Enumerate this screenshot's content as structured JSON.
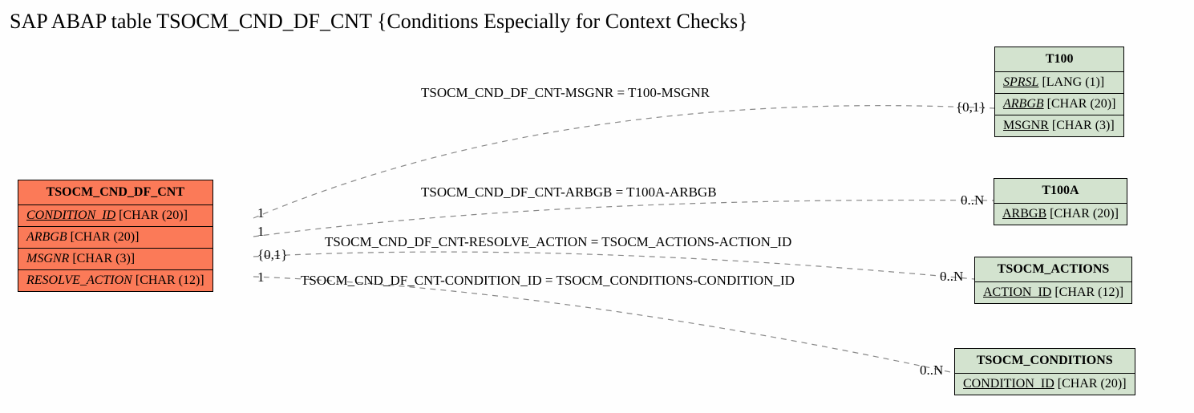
{
  "title": "SAP ABAP table TSOCM_CND_DF_CNT {Conditions Especially for Context Checks}",
  "main": {
    "name": "TSOCM_CND_DF_CNT",
    "fields": [
      {
        "label": "CONDITION_ID",
        "type": "[CHAR (20)]"
      },
      {
        "label": "ARBGB",
        "type": "[CHAR (20)]"
      },
      {
        "label": "MSGNR",
        "type": "[CHAR (3)]"
      },
      {
        "label": "RESOLVE_ACTION",
        "type": "[CHAR (12)]"
      }
    ]
  },
  "refs": {
    "t100": {
      "name": "T100",
      "fields": [
        {
          "label": "SPRSL",
          "type": "[LANG (1)]"
        },
        {
          "label": "ARBGB",
          "type": "[CHAR (20)]"
        },
        {
          "label": "MSGNR",
          "type": "[CHAR (3)]"
        }
      ]
    },
    "t100a": {
      "name": "T100A",
      "fields": [
        {
          "label": "ARBGB",
          "type": "[CHAR (20)]"
        }
      ]
    },
    "tsocm_actions": {
      "name": "TSOCM_ACTIONS",
      "fields": [
        {
          "label": "ACTION_ID",
          "type": "[CHAR (12)]"
        }
      ]
    },
    "tsocm_conditions": {
      "name": "TSOCM_CONDITIONS",
      "fields": [
        {
          "label": "CONDITION_ID",
          "type": "[CHAR (20)]"
        }
      ]
    }
  },
  "edges": {
    "e1": {
      "label": "TSOCM_CND_DF_CNT-MSGNR = T100-MSGNR",
      "card_left": "1",
      "card_right": "{0,1}"
    },
    "e2": {
      "label": "TSOCM_CND_DF_CNT-ARBGB = T100A-ARBGB",
      "card_left": "1",
      "card_right": "0..N"
    },
    "e3": {
      "label": "TSOCM_CND_DF_CNT-RESOLVE_ACTION = TSOCM_ACTIONS-ACTION_ID",
      "card_left": "{0,1}",
      "card_right": "0..N"
    },
    "e4": {
      "label": "TSOCM_CND_DF_CNT-CONDITION_ID = TSOCM_CONDITIONS-CONDITION_ID",
      "card_left": "1",
      "card_right": "0..N"
    }
  }
}
